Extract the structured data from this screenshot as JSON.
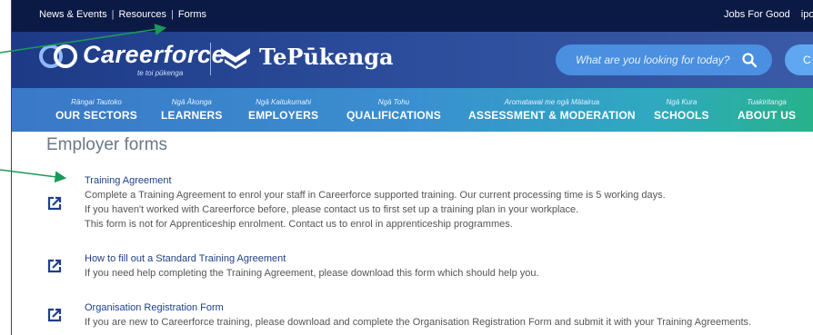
{
  "topbar": {
    "links": [
      "News & Events",
      "Resources",
      "Forms"
    ],
    "separator": "|",
    "right": [
      "Jobs For Good",
      "ipor"
    ]
  },
  "brand": {
    "name": "Careerforce",
    "tagline": "te toi pūkenga",
    "partner": "TePūkenga"
  },
  "search": {
    "placeholder": "What are you looking for today?",
    "cta_label": "C"
  },
  "nav": [
    {
      "sub": "Rāngai Tautoko",
      "label": "OUR SECTORS"
    },
    {
      "sub": "Ngā Ākonga",
      "label": "LEARNERS"
    },
    {
      "sub": "Ngā Kaitukumahi",
      "label": "EMPLOYERS"
    },
    {
      "sub": "Ngā Tohu",
      "label": "QUALIFICATIONS"
    },
    {
      "sub": "Aromatawai me ngā Mātairua",
      "label": "ASSESSMENT & MODERATION"
    },
    {
      "sub": "Ngā Kura",
      "label": "SCHOOLS"
    },
    {
      "sub": "Tuakiritanga",
      "label": "ABOUT US"
    }
  ],
  "page_title": "Employer forms",
  "forms": [
    {
      "title": "Training Agreement",
      "lines": [
        "Complete a Training Agreement to enrol your staff in Careerforce supported training. Our current processing time is 5 working days.",
        "If you haven't worked with Careerforce before, please contact us to first set up a training plan in your workplace.",
        "This form is not for Apprenticeship enrolment. Contact us to enrol in apprenticeship programmes."
      ]
    },
    {
      "title": "How to fill out a Standard Training Agreement",
      "lines": [
        "If you need help completing the Training Agreement, please download this form which should help you."
      ]
    },
    {
      "title": "Organisation Registration Form",
      "lines": [
        "If you are new to Careerforce training, please download and complete the Organisation Registration Form and submit it with your Training Agreements."
      ]
    }
  ],
  "colors": {
    "topbar": "#0b1a45",
    "nav_gradient_start": "#3a78c8",
    "nav_gradient_end": "#27b28a",
    "link": "#1f3f8a",
    "annotation_arrow": "#1a9a5a"
  }
}
